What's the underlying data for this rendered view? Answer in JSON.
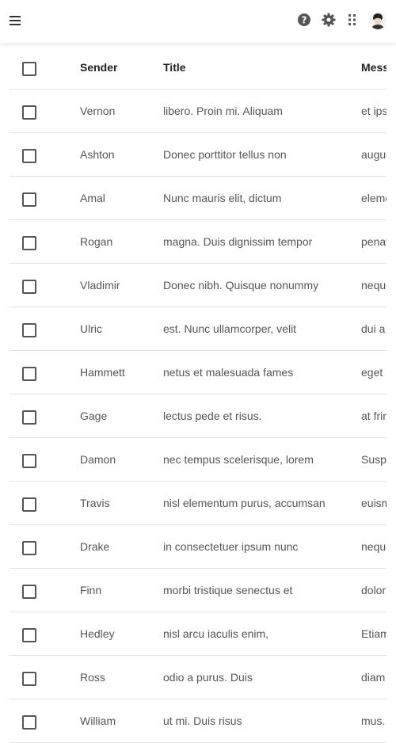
{
  "header": {
    "columns": {
      "sender": "Sender",
      "title": "Title",
      "message": "Message"
    }
  },
  "rows": [
    {
      "sender": "Vernon",
      "title": "libero. Proin mi. Aliquam",
      "message": "et ipsum"
    },
    {
      "sender": "Ashton",
      "title": "Donec porttitor tellus non",
      "message": "augue"
    },
    {
      "sender": "Amal",
      "title": "Nunc mauris elit, dictum",
      "message": "elementum"
    },
    {
      "sender": "Rogan",
      "title": "magna. Duis dignissim tempor",
      "message": "penatibus"
    },
    {
      "sender": "Vladimir",
      "title": "Donec nibh. Quisque nonummy",
      "message": "neque"
    },
    {
      "sender": "Ulric",
      "title": "est. Nunc ullamcorper, velit",
      "message": "dui a"
    },
    {
      "sender": "Hammett",
      "title": "netus et malesuada fames",
      "message": "eget"
    },
    {
      "sender": "Gage",
      "title": "lectus pede et risus.",
      "message": "at fringilla"
    },
    {
      "sender": "Damon",
      "title": "nec tempus scelerisque, lorem",
      "message": "Suspendisse"
    },
    {
      "sender": "Travis",
      "title": "nisl elementum purus, accumsan",
      "message": "euismod"
    },
    {
      "sender": "Drake",
      "title": "in consectetuer ipsum nunc",
      "message": "neque"
    },
    {
      "sender": "Finn",
      "title": "morbi tristique senectus et",
      "message": "dolor"
    },
    {
      "sender": "Hedley",
      "title": "nisl arcu iaculis enim,",
      "message": "Etiam"
    },
    {
      "sender": "Ross",
      "title": "odio a purus. Duis",
      "message": "diam"
    },
    {
      "sender": "William",
      "title": "ut mi. Duis risus",
      "message": "mus."
    }
  ]
}
